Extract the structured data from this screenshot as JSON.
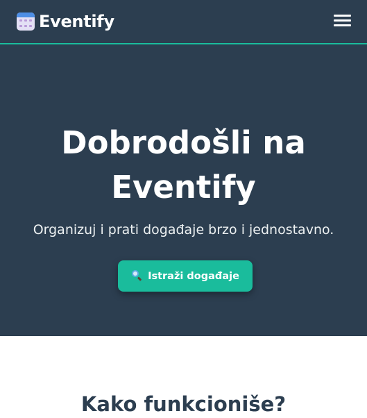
{
  "navbar": {
    "brand": "Eventify",
    "brand_icon": "calendar-icon",
    "menu_icon": "hamburger-menu-icon",
    "accent_color": "#1abc9c",
    "background_color": "#2c3e50"
  },
  "hero": {
    "title": "Dobrodošli na Eventify",
    "subtitle": "Organizuj i prati događaje brzo i jednostavno.",
    "cta_label": "Istraži događaje",
    "cta_icon": "magnifier-icon"
  },
  "how_it_works": {
    "title": "Kako funkcioniše?"
  }
}
